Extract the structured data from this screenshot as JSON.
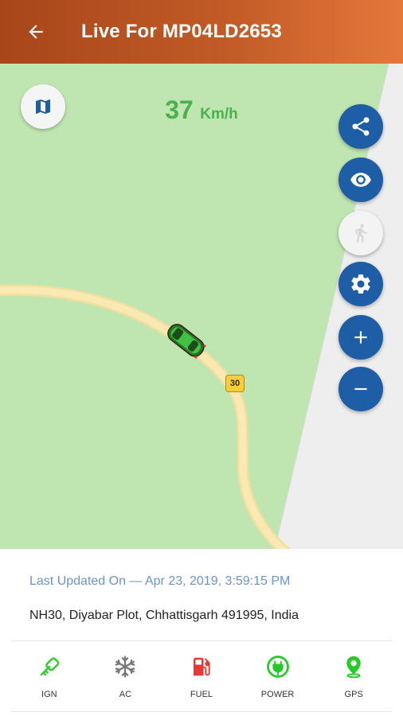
{
  "appbar": {
    "title": "Live For MP04LD2653"
  },
  "map": {
    "speed_value": "37",
    "speed_unit": "Km/h",
    "road_shield": "30"
  },
  "info": {
    "last_updated": "Last Updated On — Apr 23, 2019, 3:59:15 PM",
    "address": "NH30, Diyabar Plot, Chhattisgarh 491995, India"
  },
  "status": {
    "items": [
      {
        "label": "IGN",
        "icon": "ignition-key-icon",
        "color": "#33cc33"
      },
      {
        "label": "AC",
        "icon": "snowflake-icon",
        "color": "#777777"
      },
      {
        "label": "FUEL",
        "icon": "fuel-pump-icon",
        "color": "#e53935"
      },
      {
        "label": "POWER",
        "icon": "power-plug-icon",
        "color": "#22cc22"
      },
      {
        "label": "GPS",
        "icon": "gps-pin-icon",
        "color": "#22cc22"
      }
    ]
  },
  "colors": {
    "accent": "#1d5ea6",
    "appbar_start": "#a8461a",
    "appbar_end": "#e4783b",
    "map_green": "#bfe6b1",
    "speed_green": "#4caf50"
  }
}
